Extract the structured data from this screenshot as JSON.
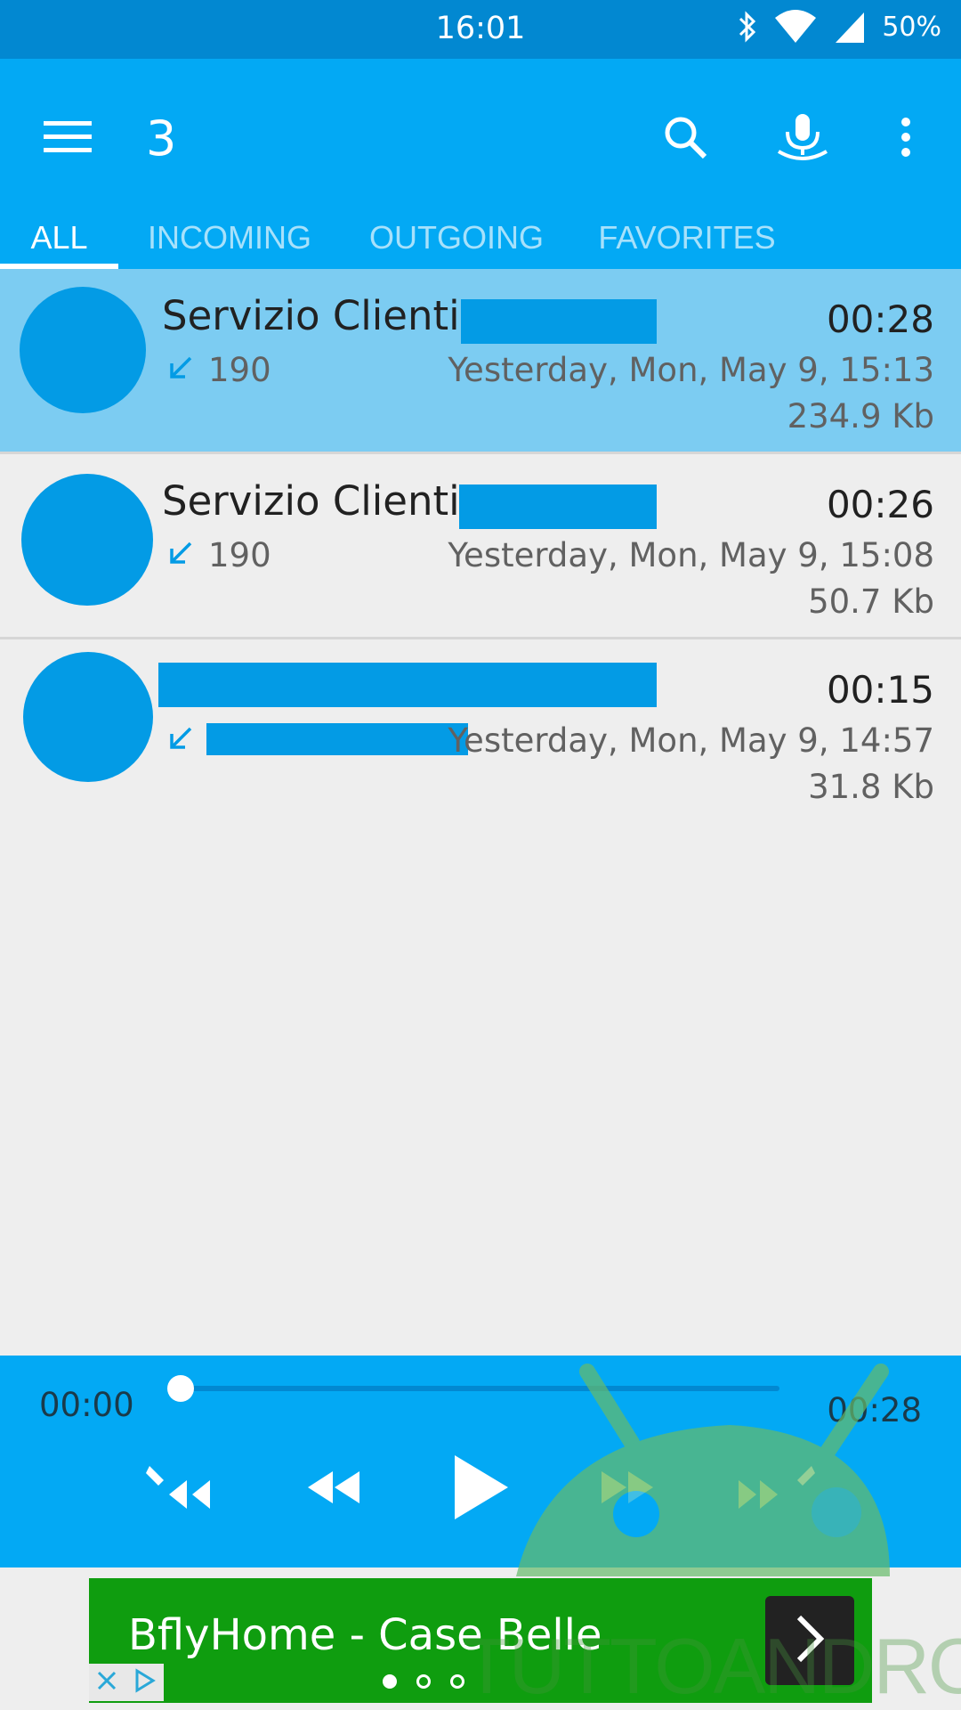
{
  "status_bar": {
    "time": "16:01",
    "battery": "50%",
    "icons": [
      "bluetooth-icon",
      "wifi-icon",
      "signal-icon"
    ]
  },
  "app_bar": {
    "title": "3",
    "icons": [
      "menu-icon",
      "search-icon",
      "mic-icon",
      "more-vert-icon"
    ],
    "accent_color": "#03a9f4",
    "status_color": "#0288d1"
  },
  "tabs": [
    {
      "label": "ALL",
      "active": true
    },
    {
      "label": "INCOMING",
      "active": false
    },
    {
      "label": "OUTGOING",
      "active": false
    },
    {
      "label": "FAVORITES",
      "active": false
    }
  ],
  "calls": [
    {
      "name": "Servizio Clienti",
      "number": "190",
      "duration": "00:28",
      "datetime": "Yesterday, Mon, May 9, 15:13",
      "size": "234.9 Kb",
      "direction": "incoming",
      "selected": true
    },
    {
      "name": "Servizio Clienti",
      "number": "190",
      "duration": "00:26",
      "datetime": "Yesterday, Mon, May 9, 15:08",
      "size": "50.7 Kb",
      "direction": "incoming",
      "selected": false
    },
    {
      "name": "",
      "number": "",
      "duration": "00:15",
      "datetime": "Yesterday, Mon, May 9, 14:57",
      "size": "31.8 Kb",
      "direction": "incoming",
      "selected": false
    }
  ],
  "player": {
    "current_time": "00:00",
    "total_time": "00:28",
    "progress": 0,
    "controls": [
      "rewind-edit-icon",
      "rewind-icon",
      "play-icon",
      "fast-forward-icon",
      "fast-forward-edit-icon"
    ]
  },
  "ad": {
    "title": "BflyHome - Case Belle",
    "page_dots": 3,
    "active_dot": 0,
    "color": "#0f9d0f"
  },
  "watermark": "TUTTOANDROID"
}
